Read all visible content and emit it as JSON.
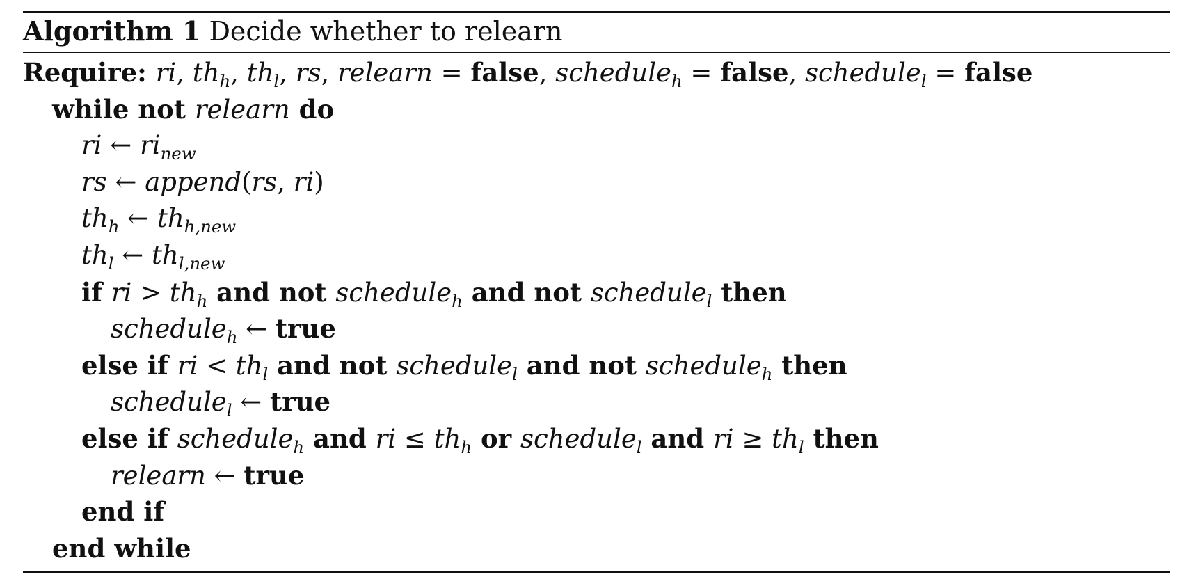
{
  "algorithm": {
    "label": "Algorithm 1",
    "title": "Decide whether to relearn",
    "require": "Require:",
    "lines": [
      {
        "indent": 0,
        "tokens": [
          {
            "t": "kw",
            "s": "Require: "
          },
          {
            "t": "v",
            "s": "ri"
          },
          {
            "t": "op",
            "s": ", "
          },
          {
            "t": "v",
            "s": "th",
            "sub": "h"
          },
          {
            "t": "op",
            "s": ", "
          },
          {
            "t": "v",
            "s": "th",
            "sub": "l"
          },
          {
            "t": "op",
            "s": ", "
          },
          {
            "t": "v",
            "s": "rs"
          },
          {
            "t": "op",
            "s": ", "
          },
          {
            "t": "v",
            "s": "relearn"
          },
          {
            "t": "op",
            "s": " = "
          },
          {
            "t": "kw",
            "s": "false"
          },
          {
            "t": "op",
            "s": ", "
          },
          {
            "t": "v",
            "s": "schedule",
            "sub": "h"
          },
          {
            "t": "op",
            "s": " = "
          },
          {
            "t": "kw",
            "s": "false"
          },
          {
            "t": "op",
            "s": ", "
          },
          {
            "t": "v",
            "s": "schedule",
            "sub": "l"
          },
          {
            "t": "op",
            "s": " = "
          },
          {
            "t": "kw",
            "s": "false"
          }
        ]
      },
      {
        "indent": 1,
        "tokens": [
          {
            "t": "kw",
            "s": "while not "
          },
          {
            "t": "v",
            "s": "relearn"
          },
          {
            "t": "kw",
            "s": " do"
          }
        ]
      },
      {
        "indent": 2,
        "tokens": [
          {
            "t": "v",
            "s": "ri"
          },
          {
            "t": "op",
            "s": " ← "
          },
          {
            "t": "v",
            "s": "ri",
            "sub": "new"
          }
        ]
      },
      {
        "indent": 2,
        "tokens": [
          {
            "t": "v",
            "s": "rs"
          },
          {
            "t": "op",
            "s": " ← "
          },
          {
            "t": "v",
            "s": "append"
          },
          {
            "t": "op",
            "s": "("
          },
          {
            "t": "v",
            "s": "rs"
          },
          {
            "t": "op",
            "s": ", "
          },
          {
            "t": "v",
            "s": "ri"
          },
          {
            "t": "op",
            "s": ")"
          }
        ]
      },
      {
        "indent": 2,
        "tokens": [
          {
            "t": "v",
            "s": "th",
            "sub": "h"
          },
          {
            "t": "op",
            "s": " ← "
          },
          {
            "t": "v",
            "s": "th",
            "sub": "h,new"
          }
        ]
      },
      {
        "indent": 2,
        "tokens": [
          {
            "t": "v",
            "s": "th",
            "sub": "l"
          },
          {
            "t": "op",
            "s": " ← "
          },
          {
            "t": "v",
            "s": "th",
            "sub": "l,new"
          }
        ]
      },
      {
        "indent": 2,
        "tokens": [
          {
            "t": "kw",
            "s": "if "
          },
          {
            "t": "v",
            "s": "ri"
          },
          {
            "t": "op",
            "s": " > "
          },
          {
            "t": "v",
            "s": "th",
            "sub": "h"
          },
          {
            "t": "kw",
            "s": " and not "
          },
          {
            "t": "v",
            "s": "schedule",
            "sub": "h"
          },
          {
            "t": "kw",
            "s": " and not "
          },
          {
            "t": "v",
            "s": "schedule",
            "sub": "l"
          },
          {
            "t": "kw",
            "s": " then"
          }
        ]
      },
      {
        "indent": 3,
        "tokens": [
          {
            "t": "v",
            "s": "schedule",
            "sub": "h"
          },
          {
            "t": "op",
            "s": " ← "
          },
          {
            "t": "kw",
            "s": "true"
          }
        ]
      },
      {
        "indent": 2,
        "tokens": [
          {
            "t": "kw",
            "s": "else if "
          },
          {
            "t": "v",
            "s": "ri"
          },
          {
            "t": "op",
            "s": " < "
          },
          {
            "t": "v",
            "s": "th",
            "sub": "l"
          },
          {
            "t": "kw",
            "s": " and not "
          },
          {
            "t": "v",
            "s": "schedule",
            "sub": "l"
          },
          {
            "t": "kw",
            "s": " and not "
          },
          {
            "t": "v",
            "s": "schedule",
            "sub": "h"
          },
          {
            "t": "kw",
            "s": " then"
          }
        ]
      },
      {
        "indent": 3,
        "tokens": [
          {
            "t": "v",
            "s": "schedule",
            "sub": "l"
          },
          {
            "t": "op",
            "s": " ← "
          },
          {
            "t": "kw",
            "s": "true"
          }
        ]
      },
      {
        "indent": 2,
        "tokens": [
          {
            "t": "kw",
            "s": "else if "
          },
          {
            "t": "v",
            "s": "schedule",
            "sub": "h"
          },
          {
            "t": "kw",
            "s": " and "
          },
          {
            "t": "v",
            "s": "ri"
          },
          {
            "t": "op",
            "s": " ≤ "
          },
          {
            "t": "v",
            "s": "th",
            "sub": "h"
          },
          {
            "t": "kw",
            "s": " or "
          },
          {
            "t": "v",
            "s": "schedule",
            "sub": "l"
          },
          {
            "t": "kw",
            "s": " and "
          },
          {
            "t": "v",
            "s": "ri"
          },
          {
            "t": "op",
            "s": " ≥ "
          },
          {
            "t": "v",
            "s": "th",
            "sub": "l"
          },
          {
            "t": "kw",
            "s": " then"
          }
        ]
      },
      {
        "indent": 3,
        "tokens": [
          {
            "t": "v",
            "s": "relearn"
          },
          {
            "t": "op",
            "s": " ← "
          },
          {
            "t": "kw",
            "s": "true"
          }
        ]
      },
      {
        "indent": 2,
        "tokens": [
          {
            "t": "kw",
            "s": "end if"
          }
        ]
      },
      {
        "indent": 1,
        "tokens": [
          {
            "t": "kw",
            "s": "end while"
          }
        ]
      }
    ]
  }
}
